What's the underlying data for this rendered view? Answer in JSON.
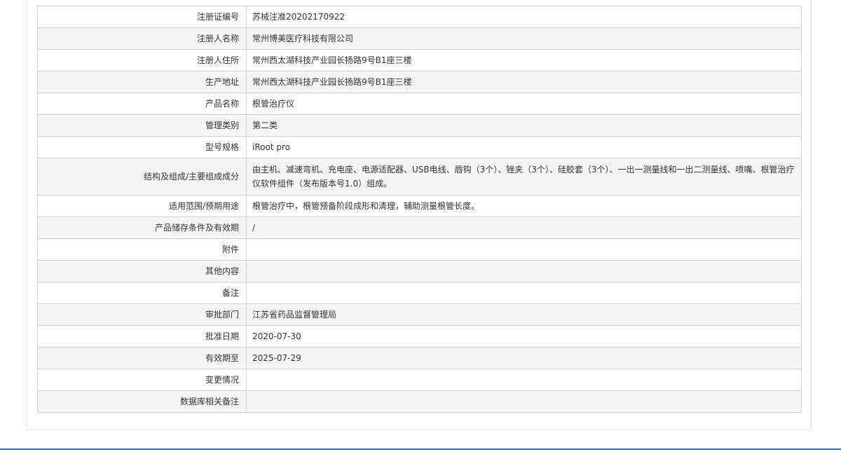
{
  "colors": {
    "border": "#d0d0d0",
    "alt_row": "#f5f5f5",
    "footer_line": "#2f6da8"
  },
  "rows": [
    {
      "label": "注册证编号",
      "value": "苏械注准20202170922"
    },
    {
      "label": "注册人名称",
      "value": "常州博美医疗科技有限公司"
    },
    {
      "label": "注册人住所",
      "value": "常州西太湖科技产业园长扬路9号B1座三楼"
    },
    {
      "label": "生产地址",
      "value": "常州西太湖科技产业园长扬路9号B1座三楼"
    },
    {
      "label": "产品名称",
      "value": "根管治疗仪"
    },
    {
      "label": "管理类别",
      "value": "第二类"
    },
    {
      "label": "型号规格",
      "value": "iRoot pro"
    },
    {
      "label": "结构及组成/主要组成成分",
      "value": "由主机、减速弯机、充电座、电源适配器、USB电线、唇钩（3个）、锉夹（3个）、硅胶套（3个）、一出一测量线和一出二测量线、喷嘴、根管治疗仪软件组件（发布版本号1.0）组成。"
    },
    {
      "label": "适用范围/预期用途",
      "value": "根管治疗中，根管预备阶段成形和清理，辅助测量根管长度。"
    },
    {
      "label": "产品储存条件及有效期",
      "value": "/"
    },
    {
      "label": "附件",
      "value": ""
    },
    {
      "label": "其他内容",
      "value": ""
    },
    {
      "label": "备注",
      "value": ""
    },
    {
      "label": "审批部门",
      "value": "江苏省药品监督管理局"
    },
    {
      "label": "批准日期",
      "value": "2020-07-30"
    },
    {
      "label": "有效期至",
      "value": "2025-07-29"
    },
    {
      "label": "变更情况",
      "value": ""
    },
    {
      "label": "数据库相关备注",
      "value": ""
    }
  ]
}
